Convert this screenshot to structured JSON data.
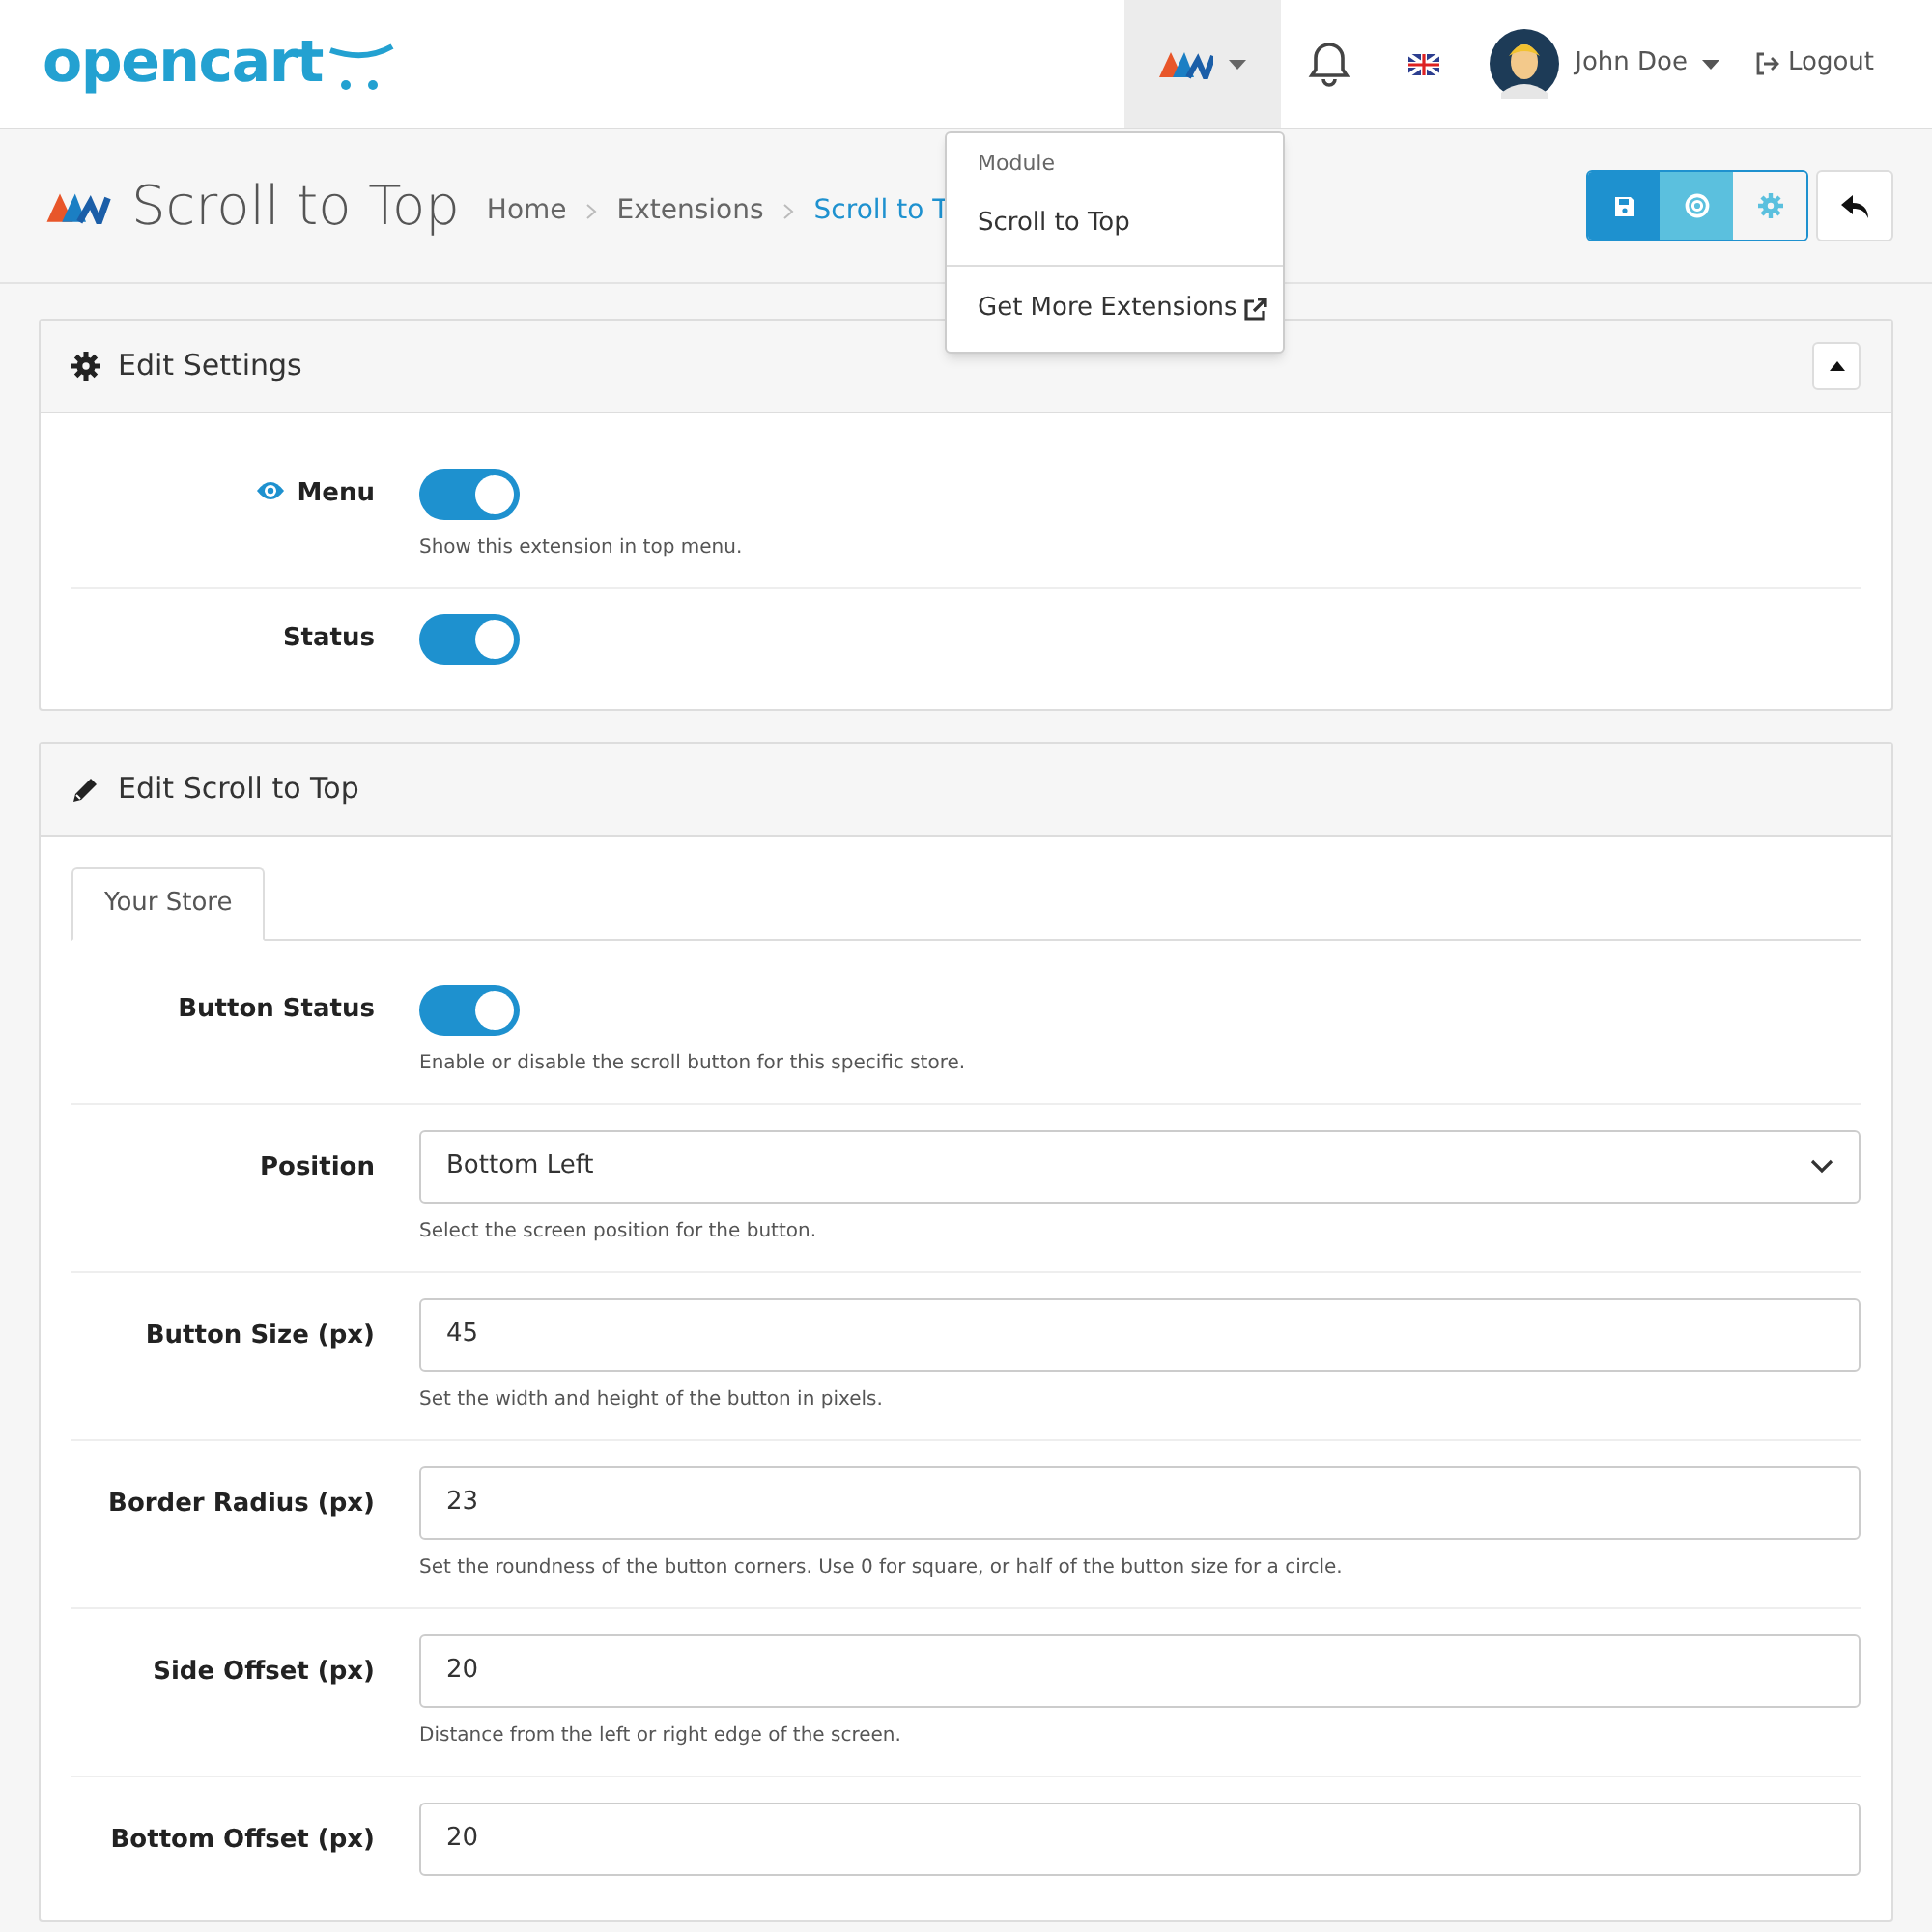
{
  "header": {
    "logo": "opencart",
    "user": "John Doe",
    "logout": "Logout"
  },
  "dropdown": {
    "heading": "Module",
    "items": [
      {
        "label": "Scroll to Top",
        "kind": "plain"
      },
      {
        "label": "Get More Extensions",
        "kind": "external"
      }
    ]
  },
  "page": {
    "title": "Scroll to Top",
    "breadcrumbs": [
      {
        "label": "Home",
        "selected": false
      },
      {
        "label": "Extensions",
        "selected": false
      },
      {
        "label": "Scroll to T",
        "selected": true
      }
    ]
  },
  "panels": [
    {
      "title": "Edit Settings",
      "fields": [
        {
          "kind": "toggle",
          "label": "Menu",
          "on": true,
          "help": "Show this extension in top menu."
        },
        {
          "kind": "toggle",
          "label": "Status",
          "on": true
        }
      ]
    },
    {
      "title": "Edit Scroll to Top",
      "tabs": [
        {
          "label": "Your Store",
          "selected": true
        }
      ],
      "fields": [
        {
          "kind": "toggle",
          "label": "Button Status",
          "on": true,
          "help": "Enable or disable the scroll button for this specific store."
        },
        {
          "kind": "select",
          "label": "Position",
          "value": "Bottom Left",
          "help": "Select the screen position for the button."
        },
        {
          "kind": "input",
          "label": "Button Size (px)",
          "value": "45",
          "help": "Set the width and height of the button in pixels."
        },
        {
          "kind": "input",
          "label": "Border Radius (px)",
          "value": "23",
          "help": "Set the roundness of the button corners. Use 0 for square, or half of the button size for a circle."
        },
        {
          "kind": "input",
          "label": "Side Offset (px)",
          "value": "20",
          "help": "Distance from the left or right edge of the screen."
        },
        {
          "kind": "input",
          "label": "Bottom Offset (px)",
          "value": "20"
        }
      ]
    }
  ]
}
